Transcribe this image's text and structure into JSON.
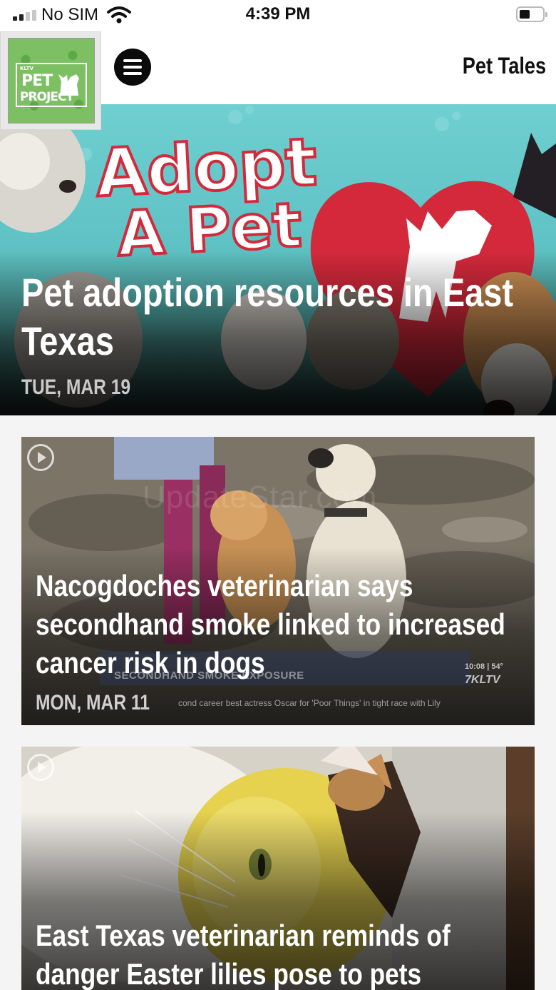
{
  "status_bar": {
    "carrier": "No SIM",
    "time": "4:39 PM"
  },
  "header": {
    "logo": {
      "small_text": "KLTV",
      "line1": "PET",
      "line2": "PROJECT"
    },
    "title": "Pet Tales"
  },
  "hero": {
    "image_text": [
      "Adopt",
      "A Pet"
    ],
    "title": "Pet adoption resources in East Texas",
    "date": "TUE, MAR 19"
  },
  "articles": [
    {
      "title": "Nacogdoches veterinarian says secondhand smoke linked to increased cancer risk in dogs",
      "date": "MON, MAR 11",
      "lower_third": "SECONDHAND SMOKE EXPOSURE",
      "ticker": "cond career best actress Oscar for 'Poor Things' in tight race with Lily",
      "station_time": "10:08 | 54°",
      "station_call": "7KLTV",
      "watermark": "UpdateStar.com",
      "has_video": true
    },
    {
      "title": "East Texas veterinarian reminds of danger Easter lilies pose to pets",
      "has_video": true
    }
  ],
  "colors": {
    "hero_teal": "#5fc2c4",
    "heart_red": "#d4293b",
    "logo_green": "#7dc064"
  }
}
